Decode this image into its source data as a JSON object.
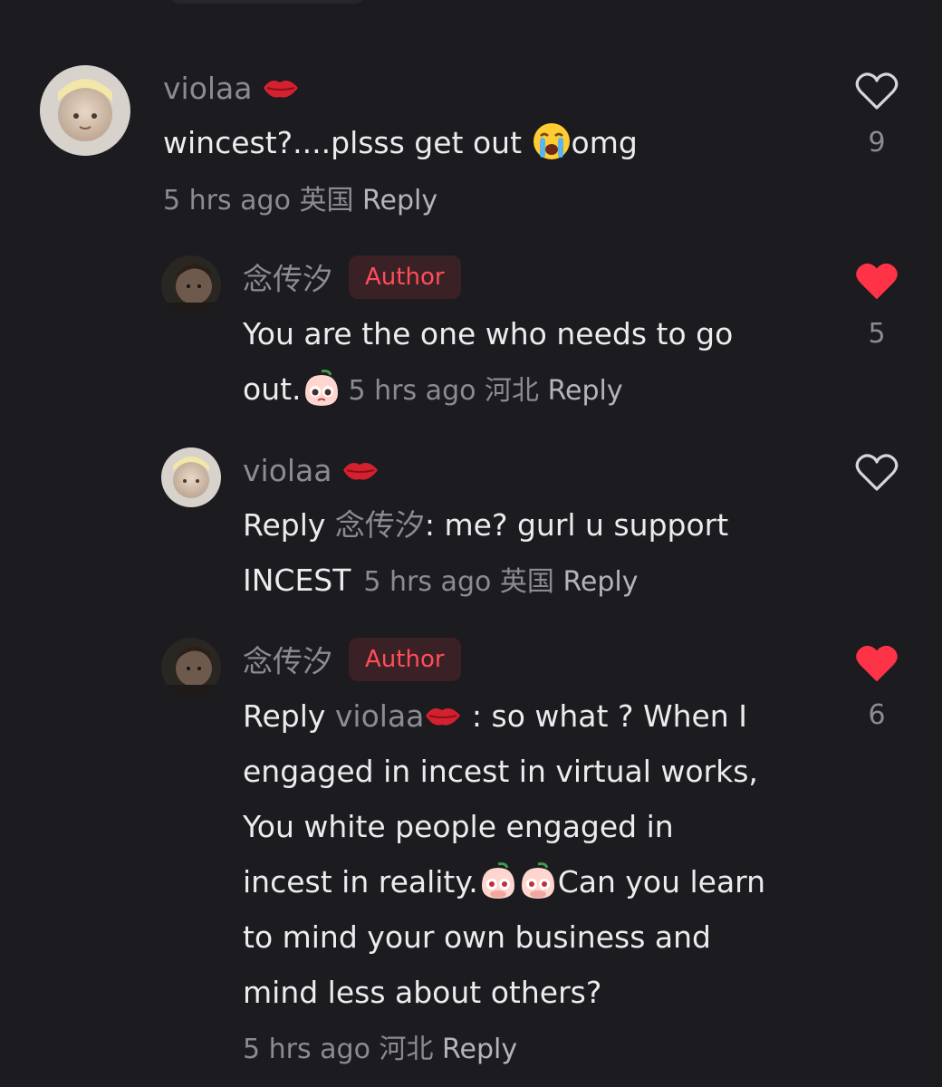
{
  "comments": [
    {
      "username": "violaa",
      "text": "wincest?....plsss get out",
      "text_suffix": "omg",
      "time": "5 hrs ago",
      "region": "英国",
      "reply_label": "Reply",
      "likes": "9",
      "liked": false
    },
    {
      "username": "念传汐",
      "badge": "Author",
      "text_line1": "You are the one who needs to go",
      "text_line2": "out.",
      "time": "5 hrs ago",
      "region": "河北",
      "reply_label": "Reply",
      "likes": "5",
      "liked": true
    },
    {
      "username": "violaa",
      "reply_prefix": "Reply",
      "reply_to": "念传汐",
      "text_line1": ": me? gurl u support",
      "text_line2": "INCEST",
      "time": "5 hrs ago",
      "region": "英国",
      "reply_label": "Reply",
      "liked": false
    },
    {
      "username": "念传汐",
      "badge": "Author",
      "reply_prefix": "Reply",
      "reply_to": "violaa",
      "text_line1": " : so what ? When I",
      "text_line2": "engaged in incest in virtual works,",
      "text_line3": "You white people engaged in",
      "text_line4a": "incest in reality.",
      "text_line4b": "Can you learn",
      "text_line5": "to mind your own business and",
      "text_line6": "mind less about others?",
      "time": "5 hrs ago",
      "region": "河北",
      "reply_label": "Reply",
      "likes": "6",
      "liked": true
    }
  ],
  "icons": {
    "lips": "kiss-mark-icon",
    "crying": "loudly-crying-face-icon",
    "peach": "pleading-peach-icon",
    "heart": "heart-icon"
  },
  "colors": {
    "background": "#1b1b20",
    "badge_text": "#ff4d5a",
    "like_active": "#ff3347"
  }
}
